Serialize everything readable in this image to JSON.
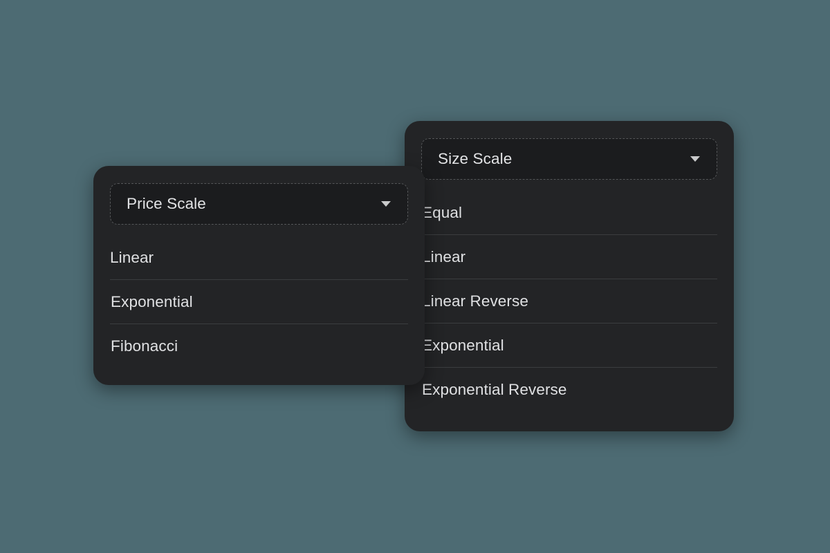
{
  "background_color": "#4d6b73",
  "panel_color": "#232426",
  "select_color": "#1b1c1e",
  "text_color": "#dfe0e2",
  "divider_color": "#3b3d3f",
  "dropdowns": [
    {
      "id": "price-scale",
      "selected_label": "Price Scale",
      "caret_icon": "chevron-down-icon",
      "options": [
        {
          "label": "Linear"
        },
        {
          "label": "Exponential"
        },
        {
          "label": "Fibonacci"
        }
      ]
    },
    {
      "id": "size-scale",
      "selected_label": "Size Scale",
      "caret_icon": "chevron-down-icon",
      "options": [
        {
          "label": "Equal"
        },
        {
          "label": "Linear"
        },
        {
          "label": "Linear Reverse"
        },
        {
          "label": "Exponential"
        },
        {
          "label": "Exponential Reverse"
        }
      ]
    }
  ]
}
